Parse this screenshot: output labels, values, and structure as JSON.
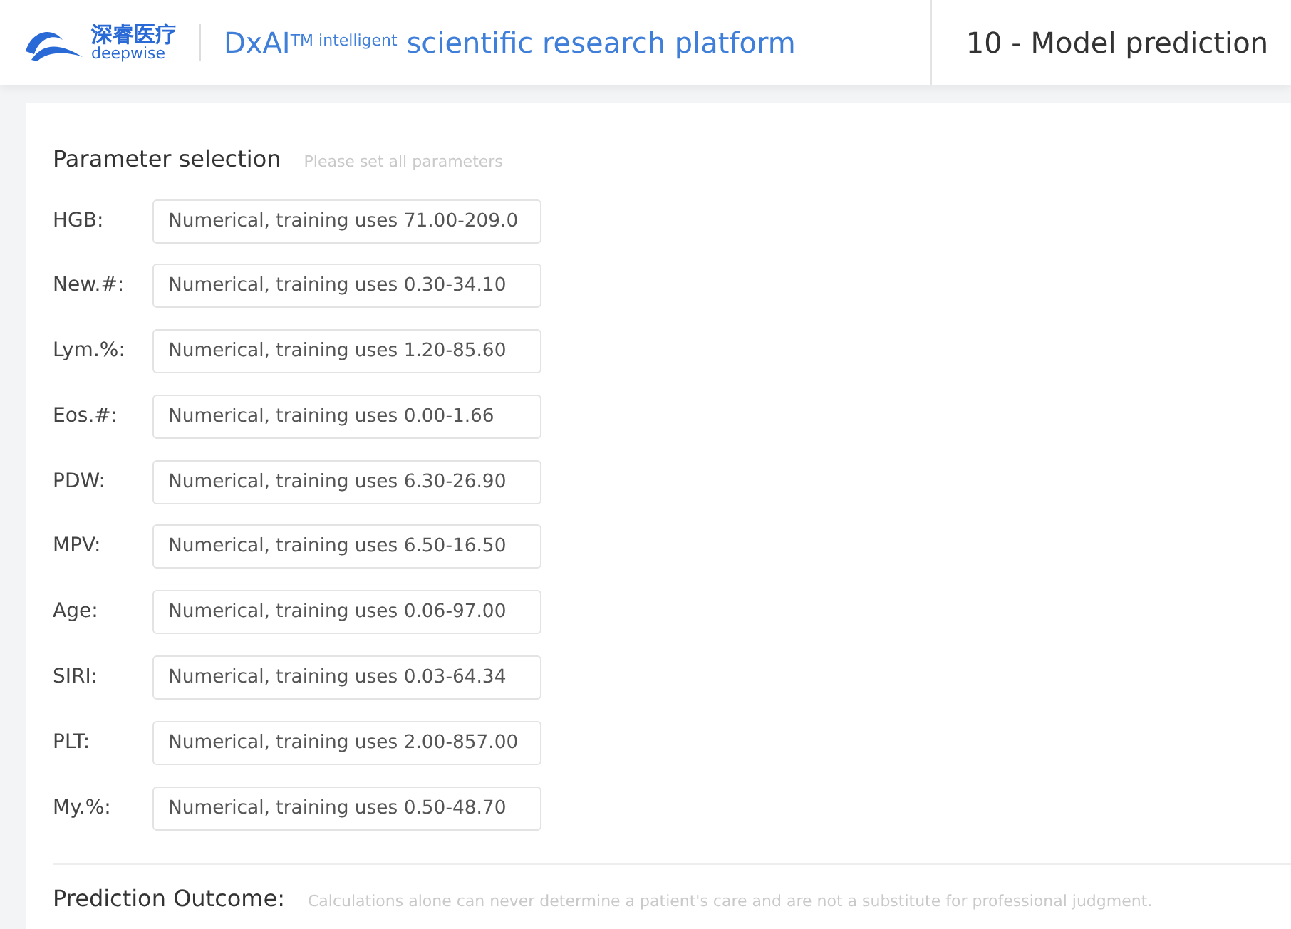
{
  "header": {
    "logo_cn": "深睿医疗",
    "logo_en": "deepwise",
    "title": "DxAI$^{TM intelligent}$ scientific research platform",
    "page_title": "10 - Model prediction"
  },
  "parameters": {
    "title": "Parameter selection",
    "hint": "Please set all parameters",
    "fields": [
      {
        "label": "HGB:",
        "placeholder": "Numerical, training uses 71.00-209.0"
      },
      {
        "label": "New.#:",
        "placeholder": "Numerical, training uses 0.30-34.10"
      },
      {
        "label": "Lym.%:",
        "placeholder": "Numerical, training uses 1.20-85.60"
      },
      {
        "label": "Eos.#:",
        "placeholder": "Numerical, training uses 0.00-1.66"
      },
      {
        "label": "PDW:",
        "placeholder": "Numerical, training uses 6.30-26.90"
      },
      {
        "label": "MPV:",
        "placeholder": "Numerical, training uses 6.50-16.50"
      },
      {
        "label": "Age:",
        "placeholder": "Numerical, training uses 0.06-97.00"
      },
      {
        "label": "SIRI:",
        "placeholder": "Numerical, training uses 0.03-64.34"
      },
      {
        "label": "PLT:",
        "placeholder": "Numerical, training uses 2.00-857.00"
      },
      {
        "label": "My.%:",
        "placeholder": "Numerical, training uses 0.50-48.70"
      }
    ]
  },
  "outcome": {
    "title": "Prediction Outcome:",
    "note": "Calculations alone can never determine a patient's care and are not a substitute for professional judgment."
  }
}
